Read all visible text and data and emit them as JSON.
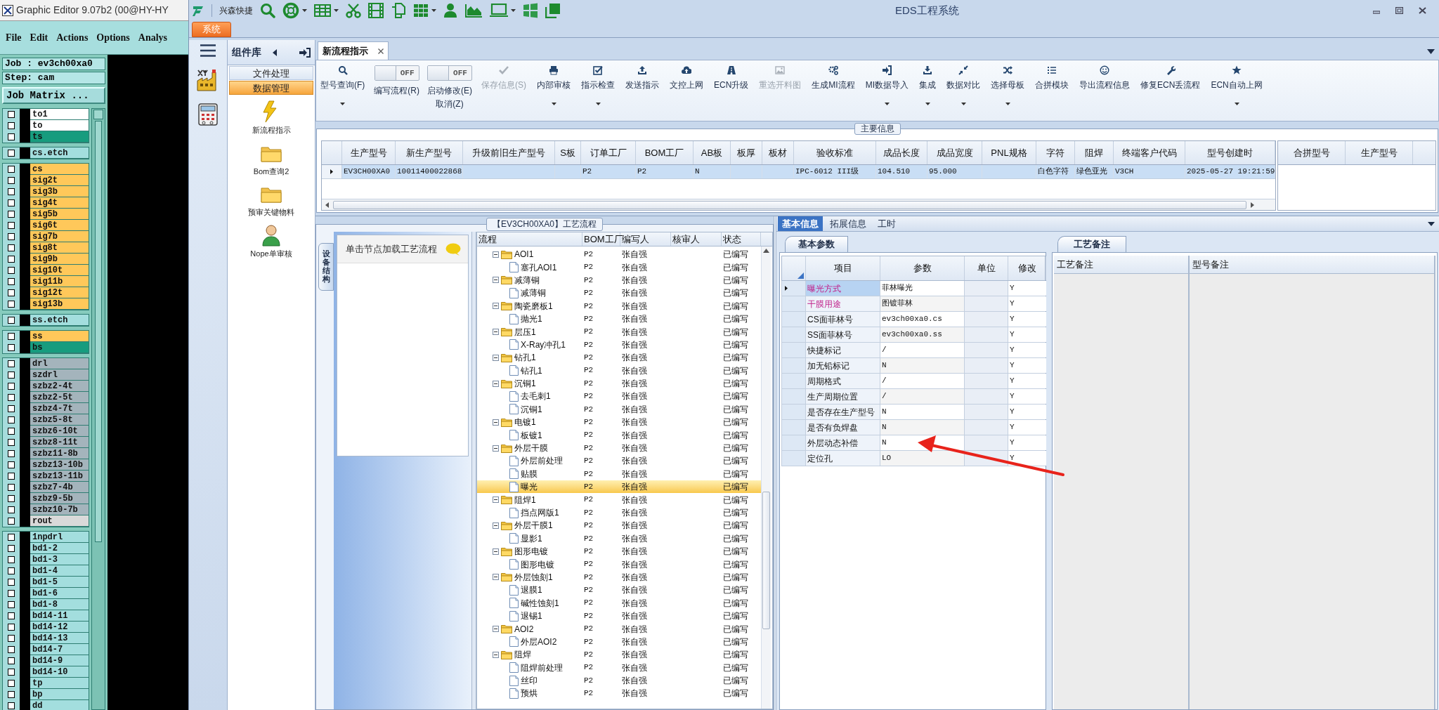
{
  "left_app": {
    "title": "Graphic Editor 9.07b2 (00@HY-HY",
    "menu": [
      "File",
      "Edit",
      "Actions",
      "Options",
      "Analys"
    ],
    "job": "Job : ev3ch00xa0",
    "step": "Step: cam",
    "matrix_button": "Job Matrix ...",
    "layer_groups": [
      {
        "layers": [
          {
            "name": "to1",
            "color": "#ffffff",
            "checked": false
          },
          {
            "name": "to",
            "color": "#ffffff",
            "checked": false
          },
          {
            "name": "ts",
            "color": "#179c7e",
            "checked": false
          }
        ]
      },
      {
        "layers": [
          {
            "name": "cs.etch",
            "color": "#a3dede",
            "checked": false
          }
        ]
      },
      {
        "layers": [
          {
            "name": "cs",
            "color": "#ffc85a",
            "checked": false
          },
          {
            "name": "sig2t",
            "color": "#ffc85a",
            "checked": false
          },
          {
            "name": "sig3b",
            "color": "#ffc85a",
            "checked": false
          },
          {
            "name": "sig4t",
            "color": "#ffc85a",
            "checked": false
          },
          {
            "name": "sig5b",
            "color": "#ffc85a",
            "checked": false
          },
          {
            "name": "sig6t",
            "color": "#ffc85a",
            "checked": false
          },
          {
            "name": "sig7b",
            "color": "#ffc85a",
            "checked": false
          },
          {
            "name": "sig8t",
            "color": "#ffc85a",
            "checked": false
          },
          {
            "name": "sig9b",
            "color": "#ffc85a",
            "checked": false
          },
          {
            "name": "sig10t",
            "color": "#ffc85a",
            "checked": false
          },
          {
            "name": "sig11b",
            "color": "#ffc85a",
            "checked": false
          },
          {
            "name": "sig12t",
            "color": "#ffc85a",
            "checked": false
          },
          {
            "name": "sig13b",
            "color": "#ffc85a",
            "checked": false
          }
        ]
      },
      {
        "layers": [
          {
            "name": "ss.etch",
            "color": "#a3dede",
            "checked": false
          }
        ]
      },
      {
        "layers": [
          {
            "name": "ss",
            "color": "#ffc85a",
            "checked": false
          },
          {
            "name": "bs",
            "color": "#179c7e",
            "checked": false
          }
        ]
      },
      {
        "layers": [
          {
            "name": "drl",
            "color": "#a4b4bc",
            "checked": false
          },
          {
            "name": "szdrl",
            "color": "#a4b4bc",
            "checked": false
          },
          {
            "name": "szbz2-4t",
            "color": "#a4b4bc",
            "checked": false
          },
          {
            "name": "szbz2-5t",
            "color": "#a4b4bc",
            "checked": false
          },
          {
            "name": "szbz4-7t",
            "color": "#a4b4bc",
            "checked": false
          },
          {
            "name": "szbz5-8t",
            "color": "#a4b4bc",
            "checked": false
          },
          {
            "name": "szbz6-10t",
            "color": "#a4b4bc",
            "checked": false
          },
          {
            "name": "szbz8-11t",
            "color": "#a4b4bc",
            "checked": false
          },
          {
            "name": "szbz11-8b",
            "color": "#a4b4bc",
            "checked": false
          },
          {
            "name": "szbz13-10b",
            "color": "#a4b4bc",
            "checked": false
          },
          {
            "name": "szbz13-11b",
            "color": "#a4b4bc",
            "checked": false
          },
          {
            "name": "szbz7-4b",
            "color": "#a4b4bc",
            "checked": false
          },
          {
            "name": "szbz9-5b",
            "color": "#a4b4bc",
            "checked": false
          },
          {
            "name": "szbz10-7b",
            "color": "#a4b4bc",
            "checked": false
          },
          {
            "name": "rout",
            "color": "#d9d9d9",
            "checked": false
          }
        ]
      },
      {
        "layers": [
          {
            "name": "1npdrl",
            "color": "#a3dede",
            "checked": false
          },
          {
            "name": "bd1-2",
            "color": "#a3dede",
            "checked": false
          },
          {
            "name": "bd1-3",
            "color": "#a3dede",
            "checked": false
          },
          {
            "name": "bd1-4",
            "color": "#a3dede",
            "checked": false
          },
          {
            "name": "bd1-5",
            "color": "#a3dede",
            "checked": false
          },
          {
            "name": "bd1-6",
            "color": "#a3dede",
            "checked": false
          },
          {
            "name": "bd1-8",
            "color": "#a3dede",
            "checked": false
          },
          {
            "name": "bd14-11",
            "color": "#a3dede",
            "checked": false
          },
          {
            "name": "bd14-12",
            "color": "#a3dede",
            "checked": false
          },
          {
            "name": "bd14-13",
            "color": "#a3dede",
            "checked": false
          },
          {
            "name": "bd14-7",
            "color": "#a3dede",
            "checked": false
          },
          {
            "name": "bd14-9",
            "color": "#a3dede",
            "checked": false
          },
          {
            "name": "bd14-10",
            "color": "#a3dede",
            "checked": false
          },
          {
            "name": "tp",
            "color": "#a3dede",
            "checked": false
          },
          {
            "name": "bp",
            "color": "#a3dede",
            "checked": false
          },
          {
            "name": "dd",
            "color": "#a3dede",
            "checked": false
          }
        ]
      }
    ]
  },
  "eds": {
    "title": "EDS工程系统",
    "quick_label": "兴森快捷",
    "system_tab": "系统",
    "sidebar": {
      "title": "组件库",
      "categories": [
        {
          "label": "文件处理",
          "selected": false
        },
        {
          "label": "数据管理",
          "selected": true
        }
      ],
      "items": [
        "新流程指示",
        "Bom查询2",
        "预审关键物料",
        "Nope单审核"
      ]
    },
    "doc_tab": "新流程指示",
    "ribbon": [
      {
        "kind": "button",
        "label": "型号查询(F)",
        "dropdown": true,
        "disabled": false
      },
      {
        "kind": "toggle",
        "label": "编写流程(R)",
        "switch_text": "OFF",
        "on": false
      },
      {
        "kind": "toggle",
        "label": "启动修改(E)",
        "label_2": "取消(Z)",
        "switch_text": "OFF",
        "on": false
      },
      {
        "kind": "button",
        "label": "保存信息(S)",
        "dropdown": false,
        "disabled": true
      },
      {
        "kind": "button",
        "label": "内部审核",
        "dropdown": true,
        "disabled": false
      },
      {
        "kind": "button",
        "label": "指示检查",
        "dropdown": true,
        "disabled": false
      },
      {
        "kind": "button",
        "label": "发送指示",
        "dropdown": false,
        "disabled": false
      },
      {
        "kind": "button",
        "label": "文控上网",
        "dropdown": false,
        "disabled": false
      },
      {
        "kind": "button",
        "label": "ECN升级",
        "dropdown": false,
        "disabled": false
      },
      {
        "kind": "button",
        "label": "重选开料图",
        "dropdown": false,
        "disabled": true
      },
      {
        "kind": "button",
        "label": "生成MI流程",
        "dropdown": false,
        "disabled": false
      },
      {
        "kind": "button",
        "label": "MI数据导入",
        "dropdown": true,
        "disabled": false
      },
      {
        "kind": "button",
        "label": "集成",
        "dropdown": true,
        "disabled": false
      },
      {
        "kind": "button",
        "label": "数据对比",
        "dropdown": true,
        "disabled": false
      },
      {
        "kind": "button",
        "label": "选择母板",
        "dropdown": true,
        "disabled": false
      },
      {
        "kind": "button",
        "label": "合拼模块",
        "dropdown": false,
        "disabled": false
      },
      {
        "kind": "button",
        "label": "导出流程信息",
        "dropdown": false,
        "disabled": false
      },
      {
        "kind": "button",
        "label": "修复ECN丢流程",
        "dropdown": false,
        "disabled": false
      },
      {
        "kind": "button",
        "label": "ECN自动上网",
        "dropdown": true,
        "disabled": false
      }
    ],
    "main_info": {
      "title": "主要信息",
      "columns": [
        "生产型号",
        "新生产型号",
        "升级前旧生产型号",
        "S板",
        "订单工厂",
        "BOM工厂",
        "AB板",
        "板厚",
        "板材",
        "验收标准",
        "成品长度",
        "成品宽度",
        "PNL规格",
        "字符",
        "阻焊",
        "终端客户代码",
        "型号创建时"
      ],
      "rows": [
        {
          "selected": true,
          "cells": [
            "EV3CH00XA0",
            "10011400022868",
            null,
            null,
            "P2",
            "P2",
            "N",
            null,
            null,
            "IPC-6012 III级",
            "104.510",
            "95.000",
            null,
            "白色字符",
            "绿色亚光",
            "V3CH",
            "2025-05-27 19:21:59"
          ]
        }
      ],
      "side_columns": [
        "合拼型号",
        "生产型号"
      ]
    },
    "flow": {
      "title": "【EV3CH00XA0】工艺流程",
      "side_tab": "设备结构",
      "hint": "单击节点加载工艺流程",
      "columns": [
        "流程",
        "BOM工厂",
        "编写人",
        "核审人",
        "状态"
      ],
      "tree": [
        {
          "label": "AOI1",
          "bom": "P2",
          "author": "张自强",
          "status": "已编写",
          "selected": false,
          "expanded": true,
          "children": [
            {
              "label": "塞孔AOI1",
              "bom": "P2",
              "author": "张自强",
              "status": "已编写",
              "selected": false
            }
          ]
        },
        {
          "label": "减薄铜",
          "bom": "P2",
          "author": "张自强",
          "status": "已编写",
          "selected": false,
          "expanded": true,
          "children": [
            {
              "label": "减薄铜",
              "bom": "P2",
              "author": "张自强",
              "status": "已编写",
              "selected": false
            }
          ]
        },
        {
          "label": "陶瓷磨板1",
          "bom": "P2",
          "author": "张自强",
          "status": "已编写",
          "selected": false,
          "expanded": true,
          "children": [
            {
              "label": "抛光1",
              "bom": "P2",
              "author": "张自强",
              "status": "已编写",
              "selected": false
            }
          ]
        },
        {
          "label": "层压1",
          "bom": "P2",
          "author": "张自强",
          "status": "已编写",
          "selected": false,
          "expanded": true,
          "children": [
            {
              "label": "X-Ray冲孔1",
              "bom": "P2",
              "author": "张自强",
              "status": "已编写",
              "selected": false
            }
          ]
        },
        {
          "label": "钻孔1",
          "bom": "P2",
          "author": "张自强",
          "status": "已编写",
          "selected": false,
          "expanded": true,
          "children": [
            {
              "label": "钻孔1",
              "bom": "P2",
              "author": "张自强",
              "status": "已编写",
              "selected": false
            }
          ]
        },
        {
          "label": "沉铜1",
          "bom": "P2",
          "author": "张自强",
          "status": "已编写",
          "selected": false,
          "expanded": true,
          "children": [
            {
              "label": "去毛刺1",
              "bom": "P2",
              "author": "张自强",
              "status": "已编写",
              "selected": false
            },
            {
              "label": "沉铜1",
              "bom": "P2",
              "author": "张自强",
              "status": "已编写",
              "selected": false
            }
          ]
        },
        {
          "label": "电镀1",
          "bom": "P2",
          "author": "张自强",
          "status": "已编写",
          "selected": false,
          "expanded": true,
          "children": [
            {
              "label": "板镀1",
              "bom": "P2",
              "author": "张自强",
              "status": "已编写",
              "selected": false
            }
          ]
        },
        {
          "label": "外层干膜",
          "bom": "P2",
          "author": "张自强",
          "status": "已编写",
          "selected": false,
          "expanded": true,
          "children": [
            {
              "label": "外层前处理",
              "bom": "P2",
              "author": "张自强",
              "status": "已编写",
              "selected": false
            },
            {
              "label": "贴膜",
              "bom": "P2",
              "author": "张自强",
              "status": "已编写",
              "selected": false
            },
            {
              "label": "曝光",
              "bom": "P2",
              "author": "张自强",
              "status": "已编写",
              "selected": true
            }
          ]
        },
        {
          "label": "阻焊1",
          "bom": "P2",
          "author": "张自强",
          "status": "已编写",
          "selected": false,
          "expanded": true,
          "children": [
            {
              "label": "挡点网版1",
              "bom": "P2",
              "author": "张自强",
              "status": "已编写",
              "selected": false
            }
          ]
        },
        {
          "label": "外层干膜1",
          "bom": "P2",
          "author": "张自强",
          "status": "已编写",
          "selected": false,
          "expanded": true,
          "children": [
            {
              "label": "显影1",
              "bom": "P2",
              "author": "张自强",
              "status": "已编写",
              "selected": false
            }
          ]
        },
        {
          "label": "图形电镀",
          "bom": "P2",
          "author": "张自强",
          "status": "已编写",
          "selected": false,
          "expanded": true,
          "children": [
            {
              "label": "图形电镀",
              "bom": "P2",
              "author": "张自强",
              "status": "已编写",
              "selected": false
            }
          ]
        },
        {
          "label": "外层蚀刻1",
          "bom": "P2",
          "author": "张自强",
          "status": "已编写",
          "selected": false,
          "expanded": true,
          "children": [
            {
              "label": "退膜1",
              "bom": "P2",
              "author": "张自强",
              "status": "已编写",
              "selected": false
            },
            {
              "label": "碱性蚀刻1",
              "bom": "P2",
              "author": "张自强",
              "status": "已编写",
              "selected": false
            },
            {
              "label": "退锡1",
              "bom": "P2",
              "author": "张自强",
              "status": "已编写",
              "selected": false
            }
          ]
        },
        {
          "label": "AOI2",
          "bom": "P2",
          "author": "张自强",
          "status": "已编写",
          "selected": false,
          "expanded": true,
          "children": [
            {
              "label": "外层AOI2",
              "bom": "P2",
              "author": "张自强",
              "status": "已编写",
              "selected": false
            }
          ]
        },
        {
          "label": "阻焊",
          "bom": "P2",
          "author": "张自强",
          "status": "已编写",
          "selected": false,
          "expanded": true,
          "children": [
            {
              "label": "阻焊前处理",
              "bom": "P2",
              "author": "张自强",
              "status": "已编写",
              "selected": false
            },
            {
              "label": "丝印",
              "bom": "P2",
              "author": "张自强",
              "status": "已编写",
              "selected": false
            },
            {
              "label": "预烘",
              "bom": "P2",
              "author": "张自强",
              "status": "已编写",
              "selected": false
            }
          ]
        }
      ]
    },
    "details": {
      "tabs": [
        {
          "label": "基本信息",
          "selected": true
        },
        {
          "label": "拓展信息",
          "selected": false
        },
        {
          "label": "工时",
          "selected": false
        }
      ],
      "params_tab": "基本参数",
      "params_columns": [
        "项目",
        "参数",
        "单位",
        "修改"
      ],
      "params": [
        {
          "item": "曝光方式",
          "value": "菲林曝光",
          "modify": "Y",
          "flagged": true,
          "selected": true
        },
        {
          "item": "干膜用途",
          "value": "图镀菲林",
          "modify": "Y",
          "flagged": true,
          "selected": false
        },
        {
          "item": "CS面菲林号",
          "value": "ev3ch00xa0.cs",
          "modify": "Y",
          "flagged": false,
          "selected": false
        },
        {
          "item": "SS面菲林号",
          "value": "ev3ch00xa0.ss",
          "modify": "Y",
          "flagged": false,
          "selected": false
        },
        {
          "item": "快捷标记",
          "value": "/",
          "modify": "Y",
          "flagged": false,
          "selected": false
        },
        {
          "item": "加无铅标记",
          "value": "N",
          "modify": "Y",
          "flagged": false,
          "selected": false
        },
        {
          "item": "周期格式",
          "value": "/",
          "modify": "Y",
          "flagged": false,
          "selected": false
        },
        {
          "item": "生产周期位置",
          "value": "/",
          "modify": "Y",
          "flagged": false,
          "selected": false
        },
        {
          "item": "是否存在生产型号",
          "value": "N",
          "modify": "Y",
          "flagged": false,
          "selected": false
        },
        {
          "item": "是否有负焊盘",
          "value": "N",
          "modify": "Y",
          "flagged": false,
          "selected": false
        },
        {
          "item": "外层动态补偿",
          "value": "N",
          "modify": "Y",
          "flagged": false,
          "selected": false
        },
        {
          "item": "定位孔",
          "value": "LO",
          "modify": "Y",
          "flagged": false,
          "selected": false
        }
      ],
      "notes_tab": "工艺备注",
      "notes_columns": [
        "工艺备注",
        "型号备注"
      ]
    }
  }
}
